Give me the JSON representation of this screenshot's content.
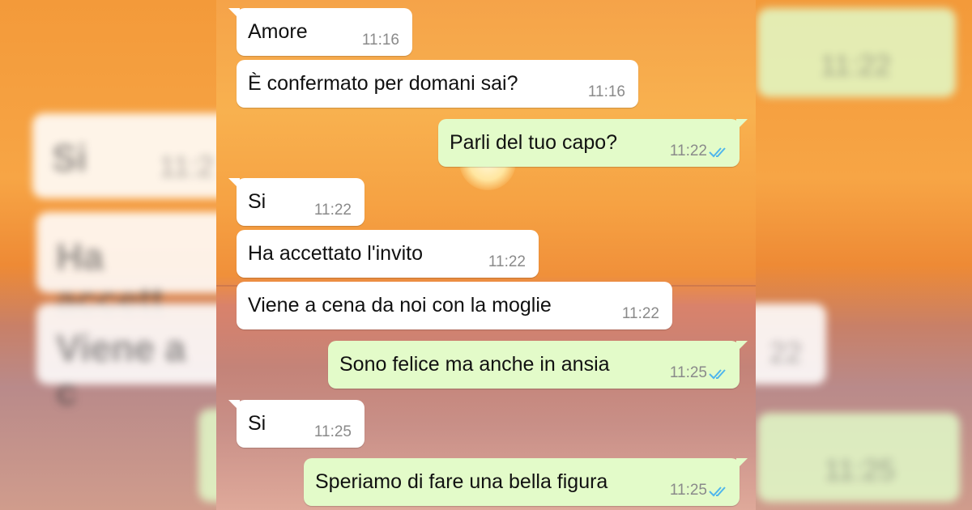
{
  "background_ghosts": {
    "left_1": "Si",
    "left_1_time": "11:2",
    "left_2": "Ha accett",
    "left_3": "Viene a c",
    "right_1_time": "11:22",
    "right_2_time": "22",
    "right_3_time": "11:25"
  },
  "messages": [
    {
      "direction": "in",
      "text": "Amore",
      "time": "11:16"
    },
    {
      "direction": "in",
      "text": "È confermato per domani sai?",
      "time": "11:16"
    },
    {
      "direction": "out",
      "text": "Parli del tuo capo?",
      "time": "11:22",
      "status": "read"
    },
    {
      "direction": "in",
      "text": "Si",
      "time": "11:22"
    },
    {
      "direction": "in",
      "text": "Ha accettato l'invito",
      "time": "11:22"
    },
    {
      "direction": "in",
      "text": "Viene a cena da noi con la moglie",
      "time": "11:22"
    },
    {
      "direction": "out",
      "text": "Sono felice ma anche in ansia",
      "time": "11:25",
      "status": "read"
    },
    {
      "direction": "in",
      "text": "Si",
      "time": "11:25"
    },
    {
      "direction": "out",
      "text": "Speriamo di fare una bella figura",
      "time": "11:25",
      "status": "read"
    }
  ],
  "colors": {
    "incoming_bubble": "#ffffff",
    "outgoing_bubble": "#e3fbc9",
    "read_ticks": "#4fb6ec",
    "timestamp": "#8a8a8a"
  },
  "icons": {
    "read_receipt": "double-check-icon"
  }
}
